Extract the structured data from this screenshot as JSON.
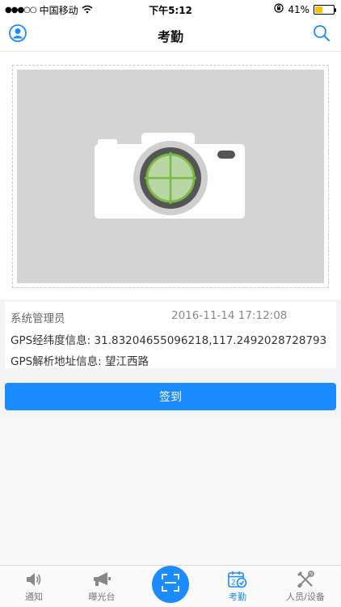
{
  "status_bar": {
    "carrier": "中国移动",
    "time": "下午5:12",
    "battery_percent": "41%",
    "battery_level": 0.41,
    "signal_dots": "●●●○○"
  },
  "nav": {
    "title": "考勤",
    "left_icon": "user-icon",
    "right_icon": "search-icon"
  },
  "attendance": {
    "photo_placeholder_icon": "camera-icon",
    "user_name": "系统管理员",
    "timestamp": "2016-11-14 17:12:08",
    "gps_coords": "GPS经纬度信息: 31.83204655096218,117.2492028728793",
    "gps_address": "GPS解析地址信息: 望江西路",
    "signin_label": "签到"
  },
  "tabs": [
    {
      "label": "通知",
      "icon": "speaker-icon",
      "active": false
    },
    {
      "label": "曝光台",
      "icon": "megaphone-icon",
      "active": false
    },
    {
      "label": "",
      "icon": "scan-icon",
      "active": false
    },
    {
      "label": "考勤",
      "icon": "calendar-check-icon",
      "active": true
    },
    {
      "label": "人员/设备",
      "icon": "tools-icon",
      "active": false
    }
  ],
  "colors": {
    "accent": "#1a8cff",
    "battery": "#f5c400",
    "placeholder_bg": "#d4d4d4"
  }
}
